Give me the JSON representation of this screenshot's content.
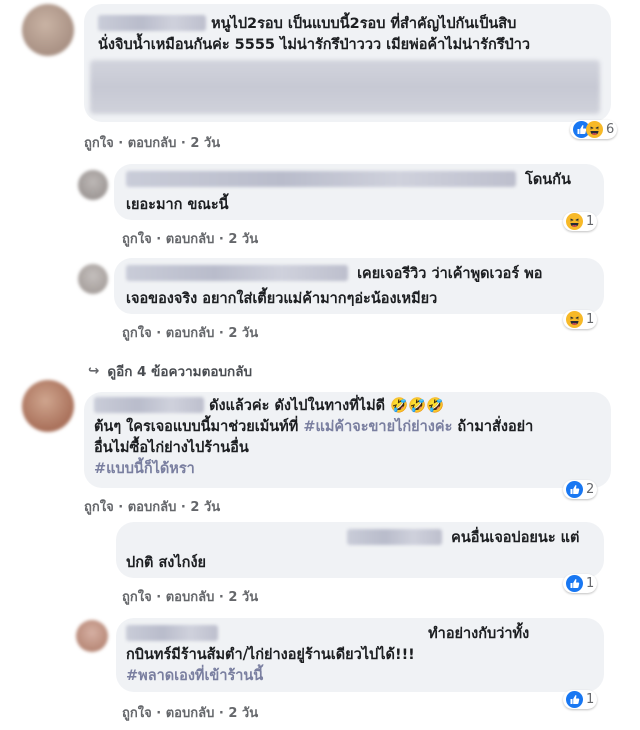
{
  "actions": {
    "like": "ถูกใจ",
    "reply": "ตอบกลับ",
    "sep": "·",
    "time": "2 วัน"
  },
  "comments": [
    {
      "line1": "หนูไป2รอบ เป็นแบบนี้2รอบ ที่สำคัญไปกันเป็นสิบ",
      "line2": "นั่งจิบน้ำเหมือนกันค่ะ 5555 ไม่น่ารักรึป่าววว เมียพ่อค้าไม่น่ารักรึป่าว",
      "reactions": {
        "icons": [
          "like-icon",
          "haha-icon"
        ],
        "count": "6"
      }
    },
    {
      "line1": "โดนกัน",
      "line2": "เยอะมาก ขณะนี้",
      "reactions": {
        "icons": [
          "haha-icon"
        ],
        "count": "1"
      }
    },
    {
      "line1": "เคยเจอรีวิว ว่าเค้าพูดเวอร์ พอ",
      "line2": "เจอของจริง อยากใส่เตี้ยวแม่ค้ามากๆอ่ะน้องเหมียว",
      "reactions": {
        "icons": [
          "haha-icon"
        ],
        "count": "1"
      }
    },
    {
      "line1": "ดังแล้วค่ะ ดังไปในทางที่ไม่ดี 🤣🤣🤣",
      "line2a": "ต้นๆ ใครเจอแบบนี้มาช่วยเม้นท์ที่ ",
      "line2tag": "#แม่ค้าจะขายไก่ย่างค่ะ",
      "line2b": " ถ้ามาสั่งอย่า",
      "line3": "อื่นไม่ซื้อไก่ย่างไปร้านอื่น",
      "line4tag": "#แบบนี้ก็ได้หรา",
      "reactions": {
        "icons": [
          "like-icon"
        ],
        "count": "2"
      }
    },
    {
      "line1": "คนอื่นเจอบ่อยนะ แต่",
      "line2": "ปกติ สงไกง์ย",
      "reactions": {
        "icons": [
          "like-icon"
        ],
        "count": "1"
      }
    },
    {
      "line1": "ทำอย่างกับว่าทั้ง",
      "line2": "กบินทร์มีร้านส้มตำ/ไก่ย่างอยู่ร้านเดียวไปได้!!!",
      "line3tag": "#พลาดเองที่เข้าร้านนี้",
      "reactions": {
        "icons": [
          "like-icon"
        ],
        "count": "1"
      }
    }
  ],
  "more_replies": {
    "arrow": "↪",
    "label": "ดูอีก 4 ข้อความตอบกลับ"
  },
  "colors": {
    "like": "#1877f2",
    "haha": "#f7b928"
  }
}
